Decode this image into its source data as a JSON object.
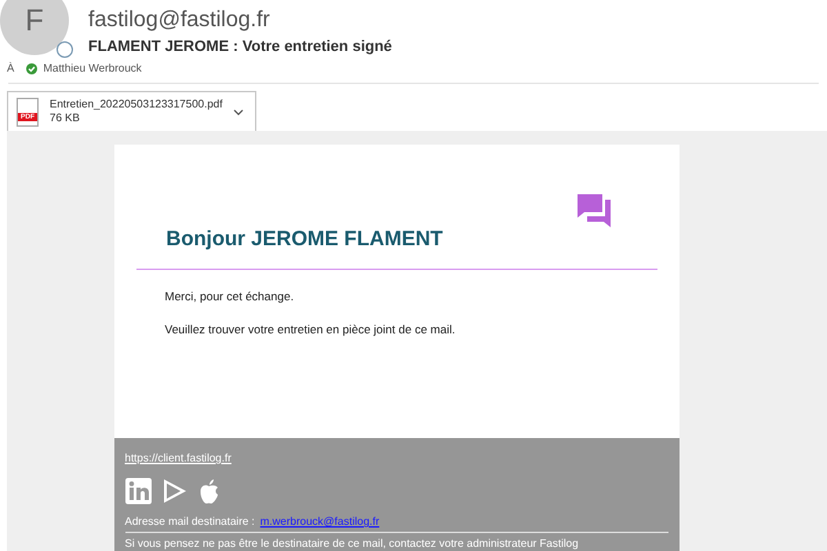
{
  "header": {
    "avatar_letter": "F",
    "sender": "fastilog@fastilog.fr",
    "subject": "FLAMENT JEROME : Votre entretien signé",
    "to_label": "À",
    "recipient": "Matthieu Werbrouck"
  },
  "attachment": {
    "badge": "PDF",
    "name": "Entretien_20220503123317500.pdf",
    "size": "76 KB"
  },
  "message": {
    "greeting": "Bonjour JEROME FLAMENT",
    "paragraphs": [
      "Merci, pour cet échange.",
      "Veuillez trouver votre entretien en pièce joint de ce mail."
    ]
  },
  "footer": {
    "link": "https://client.fastilog.fr",
    "address_label": "Adresse mail destinataire :",
    "address": "m.werbrouck@fastilog.fr",
    "notice": "Si vous pensez ne pas être le destinataire de ce mail, contactez votre administrateur Fastilog"
  }
}
